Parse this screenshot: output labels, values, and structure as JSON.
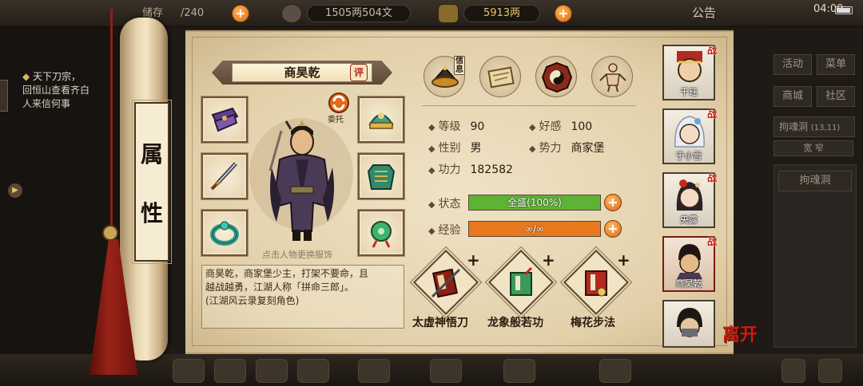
{
  "topbar": {
    "slot_text": "/240",
    "slot_prefix": "储存",
    "copper": "1505两504文",
    "gold": "5913两",
    "notice": "公告",
    "time": "04:09"
  },
  "left_panel": {
    "quest_title": "天下刀宗，",
    "quest_line1": "回恒山查看齐白",
    "quest_line2": "人来信何事"
  },
  "scroll_label": [
    "属",
    "性"
  ],
  "character": {
    "name": "商昊乾",
    "rate_label": "评",
    "entrust_label": "委托",
    "change_outfit_hint": "点击人物更换服饰",
    "bio_line1": "商昊乾，商家堡少主，打架不要命，且",
    "bio_line2": "越战越勇，江湖人称「拼命三郎」。",
    "bio_line3": "(江湖风云录复刻角色)"
  },
  "info_tabs": {
    "info_label": "信息"
  },
  "attributes": {
    "level_label": "等级",
    "level_value": "90",
    "favor_label": "好感",
    "favor_value": "100",
    "gender_label": "性别",
    "gender_value": "男",
    "faction_label": "势力",
    "faction_value": "商家堡",
    "power_label": "功力",
    "power_value": "182582"
  },
  "bars": {
    "status_label": "状态",
    "status_text": "全盛(100%)",
    "status_fill": 1.0,
    "status_color": "#5db335",
    "exp_label": "经验",
    "exp_text": "∞/∞",
    "exp_fill": 1.0,
    "exp_color": "#e8791e"
  },
  "skills": [
    {
      "name": "太虚神悟刀",
      "plus": "+"
    },
    {
      "name": "龙象般若功",
      "plus": "+"
    },
    {
      "name": "梅花步法",
      "plus": "+"
    }
  ],
  "roster": [
    {
      "name": "千珏",
      "badge": "战"
    },
    {
      "name": "于小雪",
      "badge": "战"
    },
    {
      "name": "央露",
      "badge": "战"
    },
    {
      "name": "商昊乾",
      "badge": "战"
    },
    {
      "name": "",
      "badge": ""
    }
  ],
  "leave_label": "离开",
  "right_menu": {
    "activity": "活动",
    "menu": "菜单",
    "shop": "商城",
    "community": "社区",
    "location": "拘魂洞",
    "coords": "(13,11)",
    "toggle": "宽   窄",
    "side_item": "拘魂洞"
  }
}
